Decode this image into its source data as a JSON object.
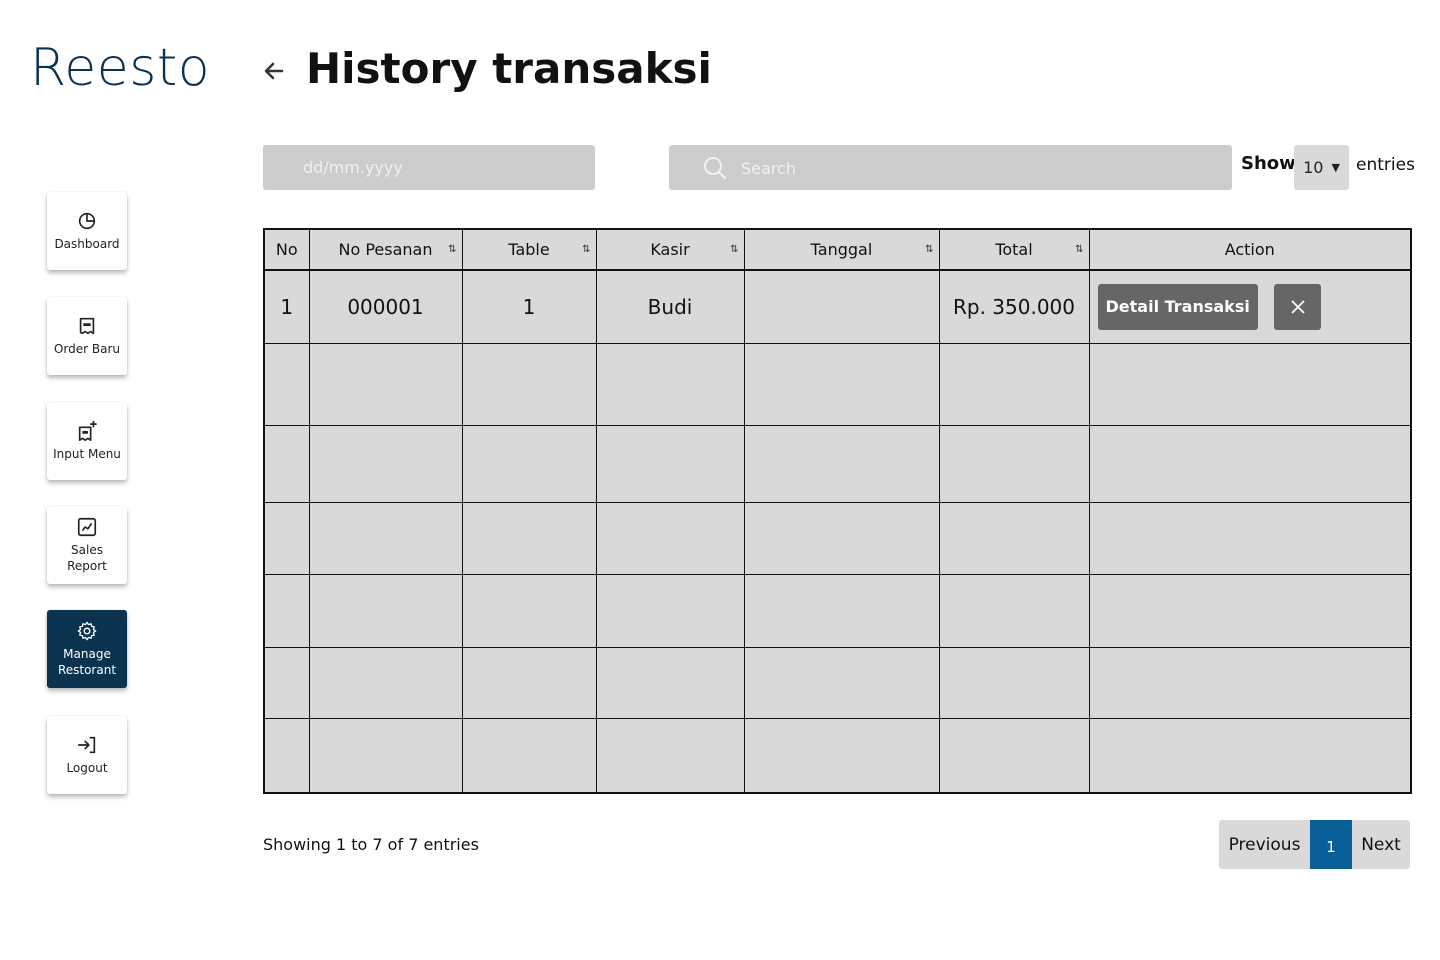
{
  "app": {
    "logo": "Reesto"
  },
  "header": {
    "title": "History transaksi"
  },
  "sidebar": {
    "items": [
      {
        "label": "Dashboard",
        "icon": "pie-chart-icon"
      },
      {
        "label": "Order Baru",
        "icon": "receipt-icon"
      },
      {
        "label": "Input Menu",
        "icon": "receipt-add-icon"
      },
      {
        "label": "Sales Report",
        "icon": "line-chart-icon"
      },
      {
        "label": "Manage Restorant",
        "icon": "gear-icon",
        "active": true
      },
      {
        "label": "Logout",
        "icon": "logout-icon"
      }
    ]
  },
  "filters": {
    "date_placeholder": "dd/mm.yyyy",
    "search_placeholder": "Search",
    "show_label": "Show",
    "show_value": "10",
    "entries_label": "entries"
  },
  "table": {
    "columns": [
      "No",
      "No Pesanan",
      "Table",
      "Kasir",
      "Tanggal",
      "Total",
      "Action"
    ],
    "rows": [
      {
        "no": "1",
        "no_pesanan": "000001",
        "table": "1",
        "kasir": "Budi",
        "tanggal": "",
        "total": "Rp. 350.000"
      }
    ],
    "detail_button": "Detail Transaksi"
  },
  "footer": {
    "showing_text": "Showing 1  to 7 of 7 entries",
    "prev_label": "Previous",
    "page": "1",
    "next_label": "Next"
  },
  "colors": {
    "brand": "#0b3350",
    "accent": "#0a5f98",
    "panel": "#d9d9d9"
  }
}
